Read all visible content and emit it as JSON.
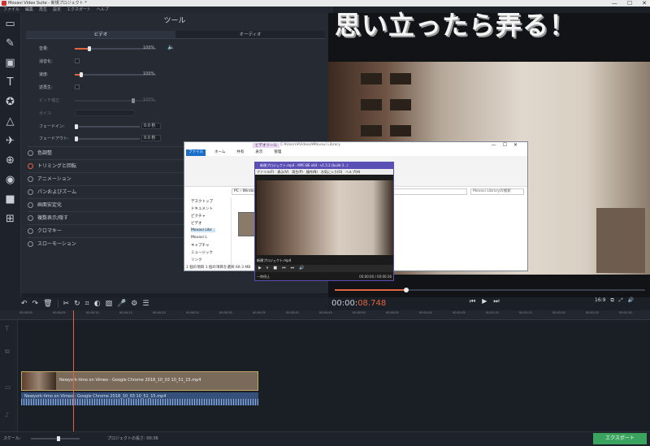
{
  "window": {
    "title": "Movavi Video Suite - 新規プロジェクト *",
    "controls": [
      "—",
      "☐",
      "✕"
    ]
  },
  "menu": [
    "ファイル",
    "編集",
    "再生",
    "設定",
    "エクスポート",
    "ヘルプ"
  ],
  "watermark": "思い立ったら弄る！",
  "tools_panel": {
    "title": "ツール",
    "tabs": [
      "ビデオ",
      "オーディオ"
    ],
    "props": [
      {
        "label": "音量:",
        "value": "100%"
      },
      {
        "label": "消音化:"
      },
      {
        "label": "速度:",
        "value": "100%"
      },
      {
        "label": "逆再生:"
      },
      {
        "label": "ピッチ補正:",
        "value": "100%"
      },
      {
        "label": "ボイス:"
      },
      {
        "label": "フェードイン:",
        "value": "0.0 秒"
      },
      {
        "label": "フェードアウト:",
        "value": "0.0 秒"
      }
    ],
    "sections": [
      "色調整",
      "トリミングと回転",
      "アニメーション",
      "パンおよびズーム",
      "画面安定化",
      "複数表示/隠す",
      "クロマキー",
      "スローモーション"
    ]
  },
  "player": {
    "timecode_main": "00:00:",
    "timecode_frac": "08.748",
    "aspect": "16:9",
    "progress": 0.23
  },
  "ruler_ticks": [
    "00:00:00",
    "00:00:05",
    "00:00:10",
    "00:00:15",
    "00:00:20",
    "00:00:25",
    "00:00:30",
    "00:00:35",
    "00:00:40",
    "00:00:45",
    "00:00:50",
    "00:00:55",
    "00:01:00",
    "00:01:05",
    "00:01:10",
    "00:01:15",
    "00:01:20",
    "00:01:25",
    "00:01:30",
    "00:01:35"
  ],
  "timeline": {
    "video_clip": "Newyork-timo on Vimeo - Google Chrome 2018_10_03 10_51_15.mp4",
    "audio_clip": "Newyork-timo on Vimeo - Google Chrome 2018_10_03 10_51_15.mp4"
  },
  "status": {
    "scale_label": "スケール:",
    "duration": "プロジェクトの長さ: 00:36",
    "export": "エクスポート"
  },
  "explorer": {
    "title": "C:¥Users¥Videos¥Movavi Library",
    "ribbon_tabs": [
      "ファイル",
      "ホーム",
      "共有",
      "表示",
      "管理"
    ],
    "context_tab": "ビデオツール",
    "address": "PC › Windows",
    "search": "Movavi Libraryの検索",
    "nav": [
      "デスクトップ",
      "ドキュメント",
      "ピクチャ",
      "ビデオ",
      "Movavi Libr",
      "Movavi L",
      "キャプチャ",
      "ミュージック",
      "リンク"
    ],
    "status": "1 個の項目  1 個の項目を選択  69.3 MB"
  },
  "mpc": {
    "title": "新規プロジェクト.mp4 - MPC-BE x64 - v1.5.2 (build 3...)",
    "menu": [
      "ファイル(F)",
      "表示(V)",
      "再生(P)",
      "操作(N)",
      "お気に入り(O)",
      "ヘルプ(H)"
    ],
    "filename": "新規プロジェクト.mp4",
    "status": "一時停止",
    "time": "00:00:00 / 00:00:36"
  }
}
